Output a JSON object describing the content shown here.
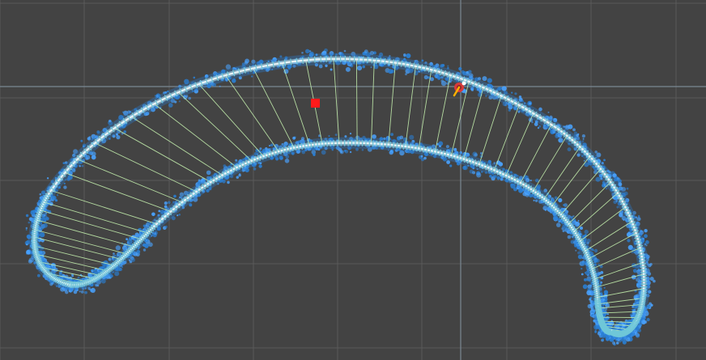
{
  "viewport": {
    "background": "#434343",
    "grid_color": "#5a5a5a",
    "axis_color": "#7a8792"
  },
  "shape": {
    "outline_color": "#e8f4f6",
    "spray_color": "#2a7fd4",
    "spray_highlight": "#4aa3ff",
    "rung_color": "#c8f5b0",
    "rung_count": 64
  },
  "markers": {
    "cursor_color": "#ff1a1a",
    "gizmo_colors": [
      "#ffb000",
      "#d83a3a",
      "#8a2a2a"
    ]
  },
  "icons": {
    "cursor": "red-square-marker",
    "gizmo": "transform-gizmo-icon"
  }
}
